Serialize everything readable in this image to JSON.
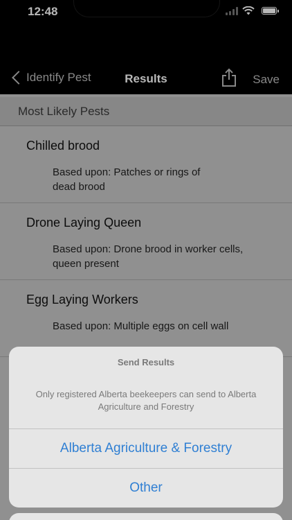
{
  "status_bar": {
    "time": "12:48"
  },
  "nav": {
    "back_label": "Identify Pest",
    "title": "Results",
    "save_label": "Save"
  },
  "section": {
    "header": "Most Likely Pests"
  },
  "pests": [
    {
      "name": "Chilled brood",
      "basis_line1": "Based upon: Patches or rings of",
      "basis_line2": "dead brood"
    },
    {
      "name": "Drone Laying Queen",
      "basis_line1": "Based upon: Drone brood in worker cells,",
      "basis_line2": "queen present"
    },
    {
      "name": "Egg Laying Workers",
      "basis_line1": "Based upon: Multiple eggs on cell wall",
      "basis_line2": ""
    }
  ],
  "action_sheet": {
    "title": "Send Results",
    "message_line1": "Only registered Alberta beekeepers can send to Alberta",
    "message_line2": "Agriculture and Forestry",
    "actions": [
      "Alberta Agriculture & Forestry",
      "Other"
    ]
  },
  "colors": {
    "accent": "#2f7fd3"
  },
  "icons": {
    "back": "chevron-left-icon",
    "share": "share-icon",
    "wifi": "wifi-icon",
    "battery": "battery-icon"
  }
}
